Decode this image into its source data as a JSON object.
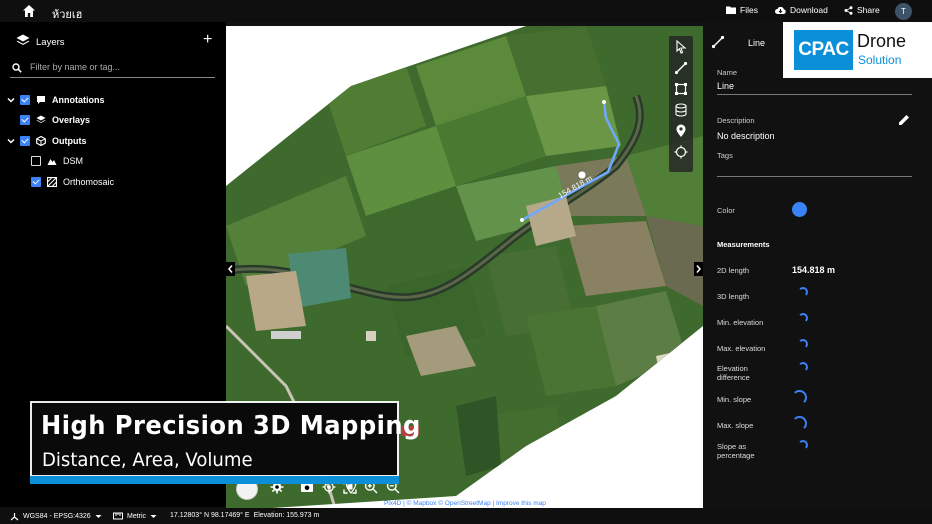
{
  "topbar": {
    "title": "ห้วยเฮ",
    "files_label": "Files",
    "download_label": "Download",
    "share_label": "Share",
    "user_initial": "T",
    "icons": [
      "home-icon",
      "folder-icon",
      "cloud-download-icon",
      "share-icon"
    ]
  },
  "layers_panel": {
    "title": "Layers",
    "search_placeholder": "Filter by name or tag...",
    "items": [
      {
        "label": "Annotations",
        "checked": true,
        "expanded": true,
        "icon": "comment-icon"
      },
      {
        "label": "Overlays",
        "checked": true,
        "icon": "layers-icon"
      },
      {
        "label": "Outputs",
        "checked": true,
        "expanded": true,
        "icon": "cube-icon"
      },
      {
        "label": "DSM",
        "checked": false,
        "icon": "mountain-icon"
      },
      {
        "label": "Orthomosaic",
        "checked": true,
        "icon": "image-icon"
      }
    ]
  },
  "map": {
    "measure_label": "154.818 m",
    "attribution": {
      "pix4d": "Pix4D",
      "mapbox": "© Mapbox",
      "osm": "© OpenStreetMap",
      "improve": "Improve this map"
    },
    "toolbar": [
      "pointer-icon",
      "line-icon",
      "polygon-icon",
      "volume-icon",
      "marker-icon",
      "crosshair-icon"
    ],
    "bottom_controls": [
      "settings-icon",
      "camera-icon",
      "locate-icon",
      "gps-icon",
      "fit-icon",
      "zoom-in-icon",
      "zoom-out-icon"
    ]
  },
  "annotation_panel": {
    "type_label": "Line",
    "name_label": "Name",
    "name_value": "Line",
    "description_label": "Description",
    "description_value": "No description",
    "tags_label": "Tags",
    "color_label": "Color",
    "color": "#3b82f6",
    "measurements_title": "Measurements",
    "measurements": [
      {
        "label": "2D length",
        "value": "154.818 m"
      },
      {
        "label": "3D length",
        "value": ""
      },
      {
        "label": "Min. elevation",
        "value": ""
      },
      {
        "label": "Max. elevation",
        "value": ""
      },
      {
        "label": "Elevation difference",
        "value": ""
      },
      {
        "label": "Min. slope",
        "value": ""
      },
      {
        "label": "Max. slope",
        "value": ""
      },
      {
        "label": "Slope as percentage",
        "value": ""
      }
    ]
  },
  "logo": {
    "brand": "CPAC",
    "word1": "Drone",
    "word2": "Solution"
  },
  "statusbar": {
    "crs": "WGS84 - EPSG:4326",
    "units": "Metric",
    "coords": "17.12803° N 98.17469° E",
    "elevation": "Elevation: 155.973 m"
  },
  "caption": {
    "line1": "High Precision 3D Mapping",
    "line2": "Distance, Area, Volume"
  },
  "colors": {
    "accent": "#3b82f6",
    "brand": "#0a8fd8"
  }
}
